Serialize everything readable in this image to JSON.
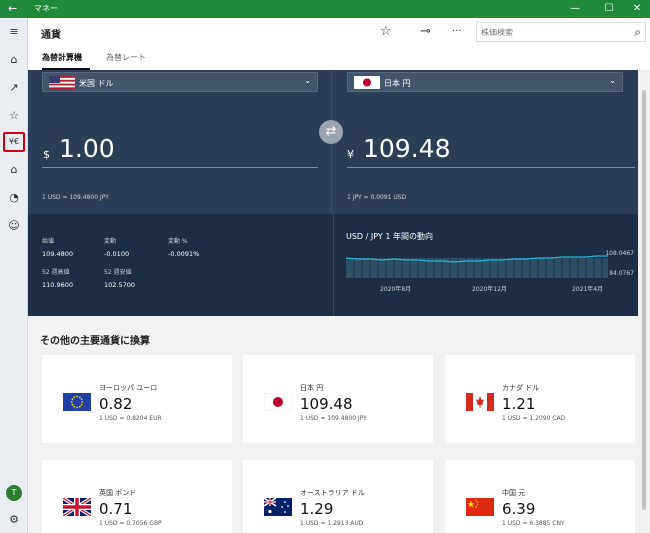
{
  "window": {
    "title": "マネー",
    "back_glyph": "←",
    "min_glyph": "—",
    "max_glyph": "☐",
    "close_glyph": "✕"
  },
  "header": {
    "title": "通貨",
    "search_placeholder": "株価検索",
    "star_glyph": "☆",
    "pin_glyph": "⊸",
    "more_glyph": "···",
    "search_glyph": "⌕"
  },
  "tabs": [
    {
      "label": "為替計算機",
      "active": true
    },
    {
      "label": "為替レート",
      "active": false
    }
  ],
  "nav": {
    "menu": "≡",
    "home": "⌂",
    "trend": "↗",
    "watchlist": "☆",
    "currency": "¥€",
    "mortgage": "⌂",
    "news": "◔",
    "feedback": "☺",
    "settings": "⚙",
    "avatar": "T"
  },
  "converter": {
    "from": {
      "name": "米国 ドル",
      "symbol": "$",
      "amount": "1.00",
      "rate": "1 USD = 109.4800 JPY"
    },
    "to": {
      "name": "日本 円",
      "symbol": "¥",
      "amount": "109.48",
      "rate": "1 JPY = 0.0091 USD"
    },
    "swap_glyph": "⇄",
    "chevron": "⌄"
  },
  "stats": [
    {
      "label": "始値",
      "value": "109.4800"
    },
    {
      "label": "変動",
      "value": "-0.0100"
    },
    {
      "label": "変動 %",
      "value": "-0.0091%"
    },
    {
      "label": "52 週高値",
      "value": "110.9600"
    },
    {
      "label": "52 週安値",
      "value": "102.5700"
    }
  ],
  "trend": {
    "title": "USD / JPY  1 年間の動向",
    "max_label": "108.0467",
    "min_label": "84.0767",
    "x_labels": [
      "2020年8月",
      "2020年12月",
      "2021年4月"
    ]
  },
  "majors": {
    "title": "その他の主要通貨に換算",
    "cards": [
      {
        "name": "ヨーロッパ ユーロ",
        "value": "0.82",
        "rate": "1 USD = 0.8204 EUR",
        "flag": "eu"
      },
      {
        "name": "日本 円",
        "value": "109.48",
        "rate": "1 USD = 109.4800 JPY",
        "flag": "jp"
      },
      {
        "name": "カナダ ドル",
        "value": "1.21",
        "rate": "1 USD = 1.2090 CAD",
        "flag": "ca"
      },
      {
        "name": "英国 ポンド",
        "value": "0.71",
        "rate": "1 USD = 0.7056 GBP",
        "flag": "gb"
      },
      {
        "name": "オーストラリア ドル",
        "value": "1.29",
        "rate": "1 USD = 1.2913 AUD",
        "flag": "au"
      },
      {
        "name": "中国 元",
        "value": "6.39",
        "rate": "1 USD = 6.3885 CNY",
        "flag": "cn"
      }
    ]
  },
  "colors": {
    "accent_green": "#1f8a3a",
    "panel": "#2c3e57",
    "panel_dark": "#1d2d45",
    "trend_line": "#27b3d8",
    "selected_outline": "#d0021b"
  }
}
